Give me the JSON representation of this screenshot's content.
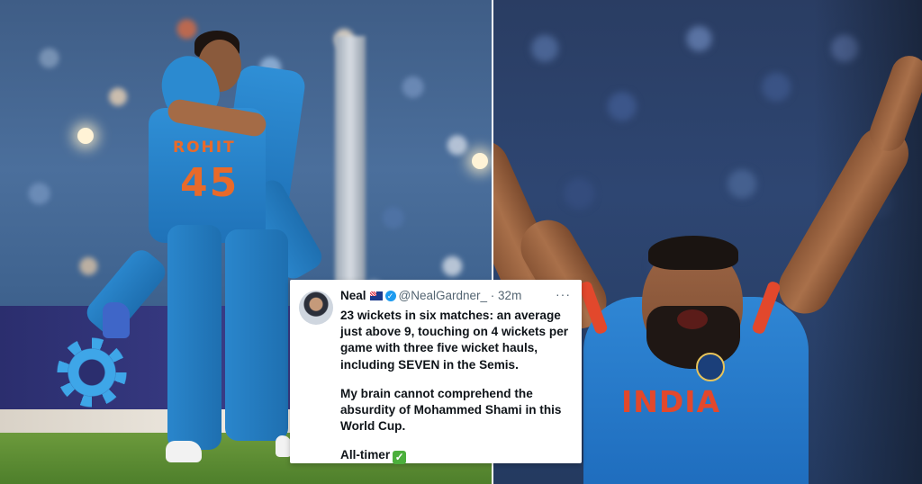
{
  "tweet": {
    "name": "Neal",
    "flag_icon": "australia-flag-icon",
    "handle": "@NealGardner_",
    "time": "32m",
    "body": [
      "23 wickets in six matches: an average just above 9, touching on 4 wickets per game with three five wicket hauls, including SEVEN in the Semis.",
      "My brain cannot comprehend the absurdity of Mohammed Shami in this World Cup.",
      "All-timer"
    ],
    "check_icon": "check-mark-icon"
  },
  "left_photo": {
    "jersey_name": "ROHIT",
    "jersey_number": "45"
  },
  "right_photo": {
    "jersey_text": "INDIA"
  },
  "colors": {
    "jersey_blue": "#2f8fd6",
    "jersey_orange": "#e86a2a",
    "india_red": "#e2482c",
    "tweet_bg": "#ffffff",
    "verified_blue": "#1d9bf0"
  }
}
